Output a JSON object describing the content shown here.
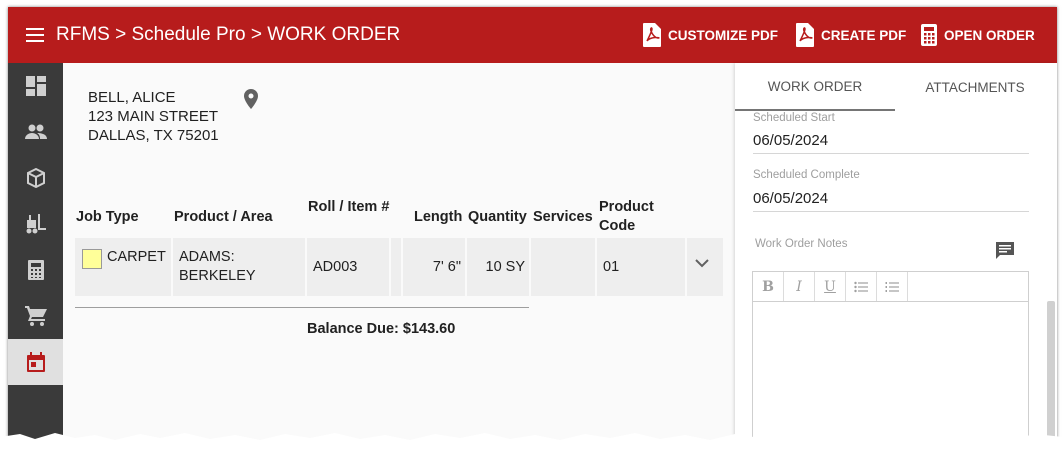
{
  "header": {
    "title": "RFMS > Schedule Pro > WORK ORDER",
    "buttons": {
      "customize_pdf": "CUSTOMIZE PDF",
      "create_pdf": "CREATE PDF",
      "open_order": "OPEN ORDER"
    },
    "bar_color": "#b71c1c"
  },
  "sidebar": {
    "items": [
      {
        "icon": "dashboard-icon"
      },
      {
        "icon": "people-icon"
      },
      {
        "icon": "package-icon"
      },
      {
        "icon": "forklift-icon"
      },
      {
        "icon": "calculator-icon"
      },
      {
        "icon": "cart-icon"
      },
      {
        "icon": "calendar-icon",
        "active": true
      }
    ]
  },
  "customer": {
    "name": "BELL, ALICE",
    "street": "123 MAIN STREET",
    "city": "DALLAS, TX 75201"
  },
  "table": {
    "headers": {
      "job_type": "Job Type",
      "product_area": "Product / Area",
      "roll_item": "Roll / Item #",
      "length": "Length",
      "quantity": "Quantity",
      "services": "Services",
      "product_code": "Product Code"
    },
    "rows": [
      {
        "job_type": "CARPET",
        "product_area": "ADAMS: BERKELEY",
        "roll_item": "AD003",
        "length": "7' 6\"",
        "quantity": "10 SY",
        "services": "",
        "product_code": "01",
        "swatch_color": "#ffff99"
      }
    ]
  },
  "balance": "Balance Due: $143.60",
  "panel": {
    "tabs": [
      "WORK ORDER",
      "ATTACHMENTS"
    ],
    "active_tab": "WORK ORDER",
    "scheduled_start_label": "Scheduled Start",
    "scheduled_start": "06/05/2024",
    "scheduled_complete_label": "Scheduled Complete",
    "scheduled_complete": "06/05/2024",
    "notes_label": "Work Order Notes",
    "editor_buttons": [
      "B",
      "I",
      "U",
      "bulleted-list-icon",
      "numbered-list-icon"
    ]
  }
}
